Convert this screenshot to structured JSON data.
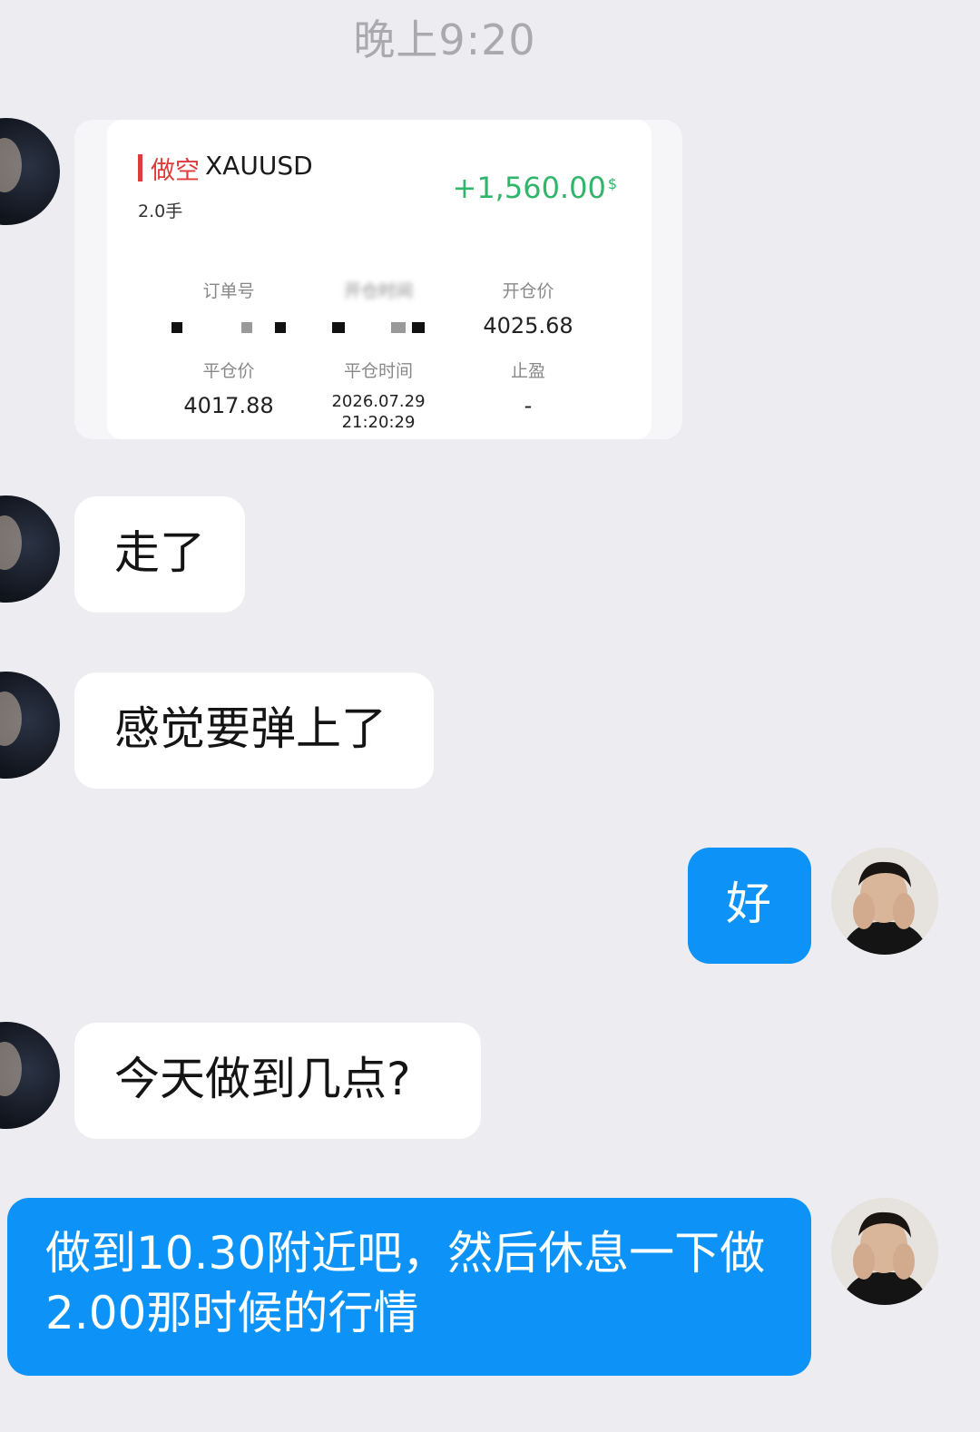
{
  "timestamp": "晚上9:20",
  "trade_card": {
    "side": "做空",
    "symbol": "XAUUSD",
    "lots": "2.0手",
    "pnl": "+1,560.00",
    "pnl_currency": "$",
    "fields": {
      "order_no_label": "订单号",
      "open_time_label": "开仓时间",
      "open_price_label": "开仓价",
      "open_price_value": "4025.68",
      "close_price_label": "平仓价",
      "close_price_value": "4017.88",
      "close_time_label": "平仓时间",
      "close_time_date": "2026.07.29",
      "close_time_clock": "21:20:29",
      "take_profit_label": "止盈",
      "take_profit_value": "-"
    }
  },
  "messages": [
    {
      "from": "other",
      "text": "走了"
    },
    {
      "from": "other",
      "text": "感觉要弹上了"
    },
    {
      "from": "me",
      "text": "好"
    },
    {
      "from": "other",
      "text": "今天做到几点?"
    },
    {
      "from": "me",
      "line1": "做到10.30附近吧，然后休息一下做",
      "line2": "2.00那时候的行情"
    }
  ]
}
